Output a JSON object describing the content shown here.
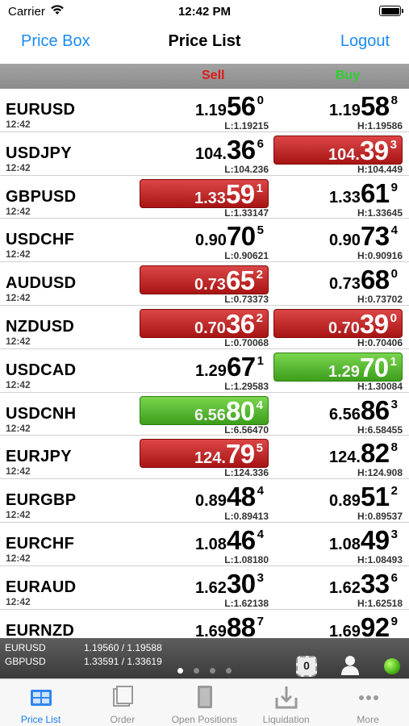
{
  "status": {
    "carrier": "Carrier",
    "time": "12:42 PM"
  },
  "nav": {
    "left": "Price Box",
    "title": "Price List",
    "right": "Logout"
  },
  "columns": {
    "sell": "Sell",
    "buy": "Buy"
  },
  "rows": [
    {
      "symbol": "EURUSD",
      "time": "12:42",
      "sell": {
        "a": "1.19",
        "b": "56",
        "c": "0",
        "state": "none"
      },
      "buy": {
        "a": "1.19",
        "b": "58",
        "c": "8",
        "state": "none"
      },
      "low": "L:1.19215",
      "high": "H:1.19586"
    },
    {
      "symbol": "USDJPY",
      "time": "12:42",
      "sell": {
        "a": "104.",
        "b": "36",
        "c": "6",
        "state": "none"
      },
      "buy": {
        "a": "104.",
        "b": "39",
        "c": "3",
        "state": "down"
      },
      "low": "L:104.236",
      "high": "H:104.449"
    },
    {
      "symbol": "GBPUSD",
      "time": "12:42",
      "sell": {
        "a": "1.33",
        "b": "59",
        "c": "1",
        "state": "down"
      },
      "buy": {
        "a": "1.33",
        "b": "61",
        "c": "9",
        "state": "none"
      },
      "low": "L:1.33147",
      "high": "H:1.33645"
    },
    {
      "symbol": "USDCHF",
      "time": "12:42",
      "sell": {
        "a": "0.90",
        "b": "70",
        "c": "5",
        "state": "none"
      },
      "buy": {
        "a": "0.90",
        "b": "73",
        "c": "4",
        "state": "none"
      },
      "low": "L:0.90621",
      "high": "H:0.90916"
    },
    {
      "symbol": "AUDUSD",
      "time": "12:42",
      "sell": {
        "a": "0.73",
        "b": "65",
        "c": "2",
        "state": "down"
      },
      "buy": {
        "a": "0.73",
        "b": "68",
        "c": "0",
        "state": "none"
      },
      "low": "L:0.73373",
      "high": "H:0.73702"
    },
    {
      "symbol": "NZDUSD",
      "time": "12:42",
      "sell": {
        "a": "0.70",
        "b": "36",
        "c": "2",
        "state": "down"
      },
      "buy": {
        "a": "0.70",
        "b": "39",
        "c": "0",
        "state": "down"
      },
      "low": "L:0.70068",
      "high": "H:0.70406"
    },
    {
      "symbol": "USDCAD",
      "time": "12:42",
      "sell": {
        "a": "1.29",
        "b": "67",
        "c": "1",
        "state": "none"
      },
      "buy": {
        "a": "1.29",
        "b": "70",
        "c": "1",
        "state": "up"
      },
      "low": "L:1.29583",
      "high": "H:1.30084"
    },
    {
      "symbol": "USDCNH",
      "time": "12:42",
      "sell": {
        "a": "6.56",
        "b": "80",
        "c": "4",
        "state": "up"
      },
      "buy": {
        "a": "6.56",
        "b": "86",
        "c": "3",
        "state": "none"
      },
      "low": "L:6.56470",
      "high": "H:6.58455"
    },
    {
      "symbol": "EURJPY",
      "time": "12:42",
      "sell": {
        "a": "124.",
        "b": "79",
        "c": "5",
        "state": "down"
      },
      "buy": {
        "a": "124.",
        "b": "82",
        "c": "8",
        "state": "none"
      },
      "low": "L:124.336",
      "high": "H:124.908"
    },
    {
      "symbol": "EURGBP",
      "time": "12:42",
      "sell": {
        "a": "0.89",
        "b": "48",
        "c": "4",
        "state": "none"
      },
      "buy": {
        "a": "0.89",
        "b": "51",
        "c": "2",
        "state": "none"
      },
      "low": "L:0.89413",
      "high": "H:0.89537"
    },
    {
      "symbol": "EURCHF",
      "time": "12:42",
      "sell": {
        "a": "1.08",
        "b": "46",
        "c": "4",
        "state": "none"
      },
      "buy": {
        "a": "1.08",
        "b": "49",
        "c": "3",
        "state": "none"
      },
      "low": "L:1.08180",
      "high": "H:1.08493"
    },
    {
      "symbol": "EURAUD",
      "time": "12:42",
      "sell": {
        "a": "1.62",
        "b": "30",
        "c": "3",
        "state": "none"
      },
      "buy": {
        "a": "1.62",
        "b": "33",
        "c": "6",
        "state": "none"
      },
      "low": "L:1.62138",
      "high": "H:1.62518"
    },
    {
      "symbol": "EURNZD",
      "time": "",
      "sell": {
        "a": "1.69",
        "b": "88",
        "c": "7",
        "state": "none"
      },
      "buy": {
        "a": "1.69",
        "b": "92",
        "c": "9",
        "state": "none"
      },
      "low": "",
      "high": ""
    }
  ],
  "ticker": [
    {
      "symbol": "EURUSD",
      "value": "1.19560  /  1.19588"
    },
    {
      "symbol": "GBPUSD",
      "value": "1.33591  /  1.33619"
    }
  ],
  "position_count": "0",
  "page_count": 4,
  "active_page": 0,
  "tabs": [
    {
      "label": "Price List",
      "icon": "price-list-icon",
      "active": true
    },
    {
      "label": "Order",
      "icon": "order-icon",
      "active": false
    },
    {
      "label": "Open Positions",
      "icon": "open-positions-icon",
      "active": false
    },
    {
      "label": "Liquidation",
      "icon": "liquidation-icon",
      "active": false
    },
    {
      "label": "More",
      "icon": "more-icon",
      "active": false
    }
  ],
  "colors": {
    "accent": "#1a8cf0",
    "sell": "#e01818",
    "buy": "#2ad12a",
    "up": "#3c9e1c",
    "down": "#a81414"
  }
}
